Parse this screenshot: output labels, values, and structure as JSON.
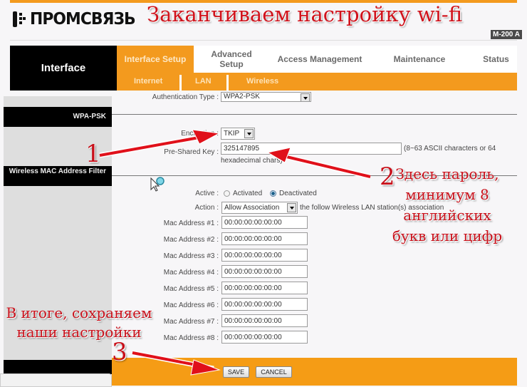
{
  "header": {
    "brand": "ПРОМСВЯЗЬ",
    "headline": "Заканчиваем настройку wi-fi",
    "model": "M-200 A"
  },
  "nav": {
    "section_title": "Interface",
    "tabs": [
      {
        "label": "Interface Setup",
        "active": true
      },
      {
        "label": "Advanced Setup",
        "active": false
      },
      {
        "label": "Access Management",
        "active": false
      },
      {
        "label": "Maintenance",
        "active": false
      },
      {
        "label": "Status",
        "active": false
      }
    ],
    "subtabs": [
      "Internet",
      "LAN",
      "Wireless"
    ]
  },
  "sidebar": {
    "sections": [
      "WPA-PSK",
      "Wireless MAC Address Filter"
    ]
  },
  "form": {
    "auth_type": {
      "label": "Authentication Type :",
      "value": "WPA2-PSK"
    },
    "encryption": {
      "label": "Encryption :",
      "value": "TKIP"
    },
    "psk": {
      "label": "Pre-Shared Key :",
      "value": "325147895",
      "hint": "(8~63 ASCII characters or 64",
      "hint2": "hexadecimal chars)"
    },
    "active": {
      "label": "Active :",
      "options": [
        "Activated",
        "Deactivated"
      ],
      "selected": "Deactivated"
    },
    "action": {
      "label": "Action :",
      "value": "Allow Association",
      "suffix": "the follow Wireless LAN station(s) association"
    },
    "mac_addresses": [
      {
        "label": "Mac Address #1 :",
        "value": "00:00:00:00:00:00"
      },
      {
        "label": "Mac Address #2 :",
        "value": "00:00:00:00:00:00"
      },
      {
        "label": "Mac Address #3 :",
        "value": "00:00:00:00:00:00"
      },
      {
        "label": "Mac Address #4 :",
        "value": "00:00:00:00:00:00"
      },
      {
        "label": "Mac Address #5 :",
        "value": "00:00:00:00:00:00"
      },
      {
        "label": "Mac Address #6 :",
        "value": "00:00:00:00:00:00"
      },
      {
        "label": "Mac Address #7 :",
        "value": "00:00:00:00:00:00"
      },
      {
        "label": "Mac Address #8 :",
        "value": "00:00:00:00:00:00"
      }
    ]
  },
  "buttons": {
    "save": "SAVE",
    "cancel": "CANCEL"
  },
  "annotations": {
    "step1": "1",
    "step2": "2",
    "step2_text": [
      "Здесь пароль,",
      "минимум 8",
      "английских",
      "букв или цифр"
    ],
    "step3": "3",
    "step3_text": [
      "В итоге, сохраняем",
      "наши настройки"
    ]
  },
  "colors": {
    "accent": "#f39a1e",
    "annotation": "#c8101a",
    "nav_black": "#000000"
  }
}
